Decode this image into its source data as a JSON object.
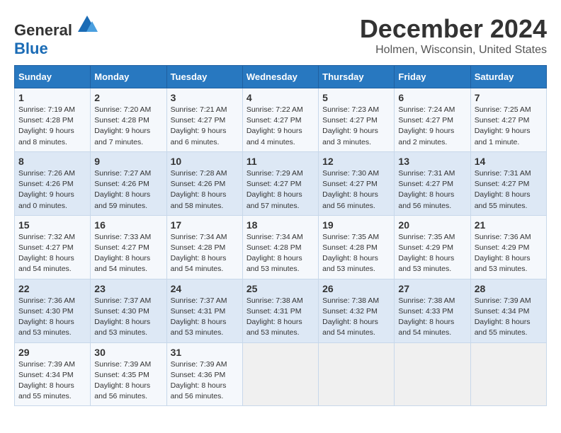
{
  "logo": {
    "general": "General",
    "blue": "Blue"
  },
  "title": "December 2024",
  "subtitle": "Holmen, Wisconsin, United States",
  "days_of_week": [
    "Sunday",
    "Monday",
    "Tuesday",
    "Wednesday",
    "Thursday",
    "Friday",
    "Saturday"
  ],
  "weeks": [
    [
      {
        "day": "1",
        "sunrise": "7:19 AM",
        "sunset": "4:28 PM",
        "daylight": "9 hours and 8 minutes."
      },
      {
        "day": "2",
        "sunrise": "7:20 AM",
        "sunset": "4:28 PM",
        "daylight": "9 hours and 7 minutes."
      },
      {
        "day": "3",
        "sunrise": "7:21 AM",
        "sunset": "4:27 PM",
        "daylight": "9 hours and 6 minutes."
      },
      {
        "day": "4",
        "sunrise": "7:22 AM",
        "sunset": "4:27 PM",
        "daylight": "9 hours and 4 minutes."
      },
      {
        "day": "5",
        "sunrise": "7:23 AM",
        "sunset": "4:27 PM",
        "daylight": "9 hours and 3 minutes."
      },
      {
        "day": "6",
        "sunrise": "7:24 AM",
        "sunset": "4:27 PM",
        "daylight": "9 hours and 2 minutes."
      },
      {
        "day": "7",
        "sunrise": "7:25 AM",
        "sunset": "4:27 PM",
        "daylight": "9 hours and 1 minute."
      }
    ],
    [
      {
        "day": "8",
        "sunrise": "7:26 AM",
        "sunset": "4:26 PM",
        "daylight": "9 hours and 0 minutes."
      },
      {
        "day": "9",
        "sunrise": "7:27 AM",
        "sunset": "4:26 PM",
        "daylight": "8 hours and 59 minutes."
      },
      {
        "day": "10",
        "sunrise": "7:28 AM",
        "sunset": "4:26 PM",
        "daylight": "8 hours and 58 minutes."
      },
      {
        "day": "11",
        "sunrise": "7:29 AM",
        "sunset": "4:27 PM",
        "daylight": "8 hours and 57 minutes."
      },
      {
        "day": "12",
        "sunrise": "7:30 AM",
        "sunset": "4:27 PM",
        "daylight": "8 hours and 56 minutes."
      },
      {
        "day": "13",
        "sunrise": "7:31 AM",
        "sunset": "4:27 PM",
        "daylight": "8 hours and 56 minutes."
      },
      {
        "day": "14",
        "sunrise": "7:31 AM",
        "sunset": "4:27 PM",
        "daylight": "8 hours and 55 minutes."
      }
    ],
    [
      {
        "day": "15",
        "sunrise": "7:32 AM",
        "sunset": "4:27 PM",
        "daylight": "8 hours and 54 minutes."
      },
      {
        "day": "16",
        "sunrise": "7:33 AM",
        "sunset": "4:27 PM",
        "daylight": "8 hours and 54 minutes."
      },
      {
        "day": "17",
        "sunrise": "7:34 AM",
        "sunset": "4:28 PM",
        "daylight": "8 hours and 54 minutes."
      },
      {
        "day": "18",
        "sunrise": "7:34 AM",
        "sunset": "4:28 PM",
        "daylight": "8 hours and 53 minutes."
      },
      {
        "day": "19",
        "sunrise": "7:35 AM",
        "sunset": "4:28 PM",
        "daylight": "8 hours and 53 minutes."
      },
      {
        "day": "20",
        "sunrise": "7:35 AM",
        "sunset": "4:29 PM",
        "daylight": "8 hours and 53 minutes."
      },
      {
        "day": "21",
        "sunrise": "7:36 AM",
        "sunset": "4:29 PM",
        "daylight": "8 hours and 53 minutes."
      }
    ],
    [
      {
        "day": "22",
        "sunrise": "7:36 AM",
        "sunset": "4:30 PM",
        "daylight": "8 hours and 53 minutes."
      },
      {
        "day": "23",
        "sunrise": "7:37 AM",
        "sunset": "4:30 PM",
        "daylight": "8 hours and 53 minutes."
      },
      {
        "day": "24",
        "sunrise": "7:37 AM",
        "sunset": "4:31 PM",
        "daylight": "8 hours and 53 minutes."
      },
      {
        "day": "25",
        "sunrise": "7:38 AM",
        "sunset": "4:31 PM",
        "daylight": "8 hours and 53 minutes."
      },
      {
        "day": "26",
        "sunrise": "7:38 AM",
        "sunset": "4:32 PM",
        "daylight": "8 hours and 54 minutes."
      },
      {
        "day": "27",
        "sunrise": "7:38 AM",
        "sunset": "4:33 PM",
        "daylight": "8 hours and 54 minutes."
      },
      {
        "day": "28",
        "sunrise": "7:39 AM",
        "sunset": "4:34 PM",
        "daylight": "8 hours and 55 minutes."
      }
    ],
    [
      {
        "day": "29",
        "sunrise": "7:39 AM",
        "sunset": "4:34 PM",
        "daylight": "8 hours and 55 minutes."
      },
      {
        "day": "30",
        "sunrise": "7:39 AM",
        "sunset": "4:35 PM",
        "daylight": "8 hours and 56 minutes."
      },
      {
        "day": "31",
        "sunrise": "7:39 AM",
        "sunset": "4:36 PM",
        "daylight": "8 hours and 56 minutes."
      },
      null,
      null,
      null,
      null
    ]
  ]
}
